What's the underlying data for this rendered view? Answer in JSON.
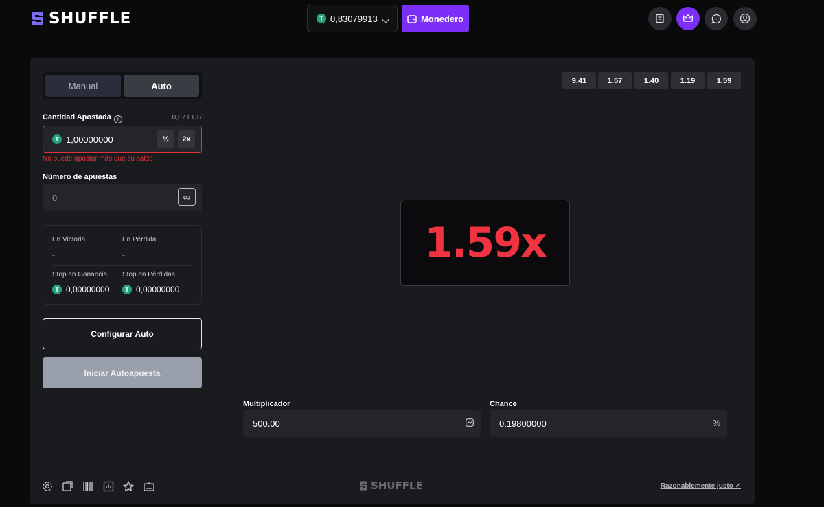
{
  "header": {
    "logo_text": "SHUFFLE",
    "balance": "0,83079913",
    "wallet_label": "Monedero"
  },
  "bet_panel": {
    "tabs": [
      {
        "label": "Manual"
      },
      {
        "label": "Auto"
      }
    ],
    "amount_label": "Cantidad Apostada",
    "amount_fiat": "0,87 EUR",
    "amount_value": "1,00000000",
    "half_label": "½",
    "double_label": "2x",
    "error_text": "No puede apostar más que su saldo",
    "num_bets_label": "Número de apuestas",
    "num_bets_placeholder": "0",
    "infinite_label": "∞",
    "on_win_label": "En Victoria",
    "on_win_value": "-",
    "on_loss_label": "En Pérdida",
    "on_loss_value": "-",
    "stop_profit_label": "Stop en Ganancia",
    "stop_profit_value": "0,00000000",
    "stop_loss_label": "Stop en Pérdidas",
    "stop_loss_value": "0,00000000",
    "configure_label": "Configurar Auto",
    "start_label": "Iniciar Autoapuesta"
  },
  "game": {
    "history": [
      "9.41",
      "1.57",
      "1.40",
      "1.19",
      "1.59"
    ],
    "result": "1.59x",
    "result_color": "#ef3340",
    "multiplier_label": "Multiplicador",
    "multiplier_value": "500.00",
    "chance_label": "Chance",
    "chance_value": "0.19800000",
    "chance_suffix": "%"
  },
  "footer": {
    "logo_text": "SHUFFLE",
    "fair_label": "Razonablemente justo",
    "icons": [
      "settings-icon",
      "popout-icon",
      "barcode-icon",
      "stats-icon",
      "star-icon",
      "keyboard-icon"
    ]
  },
  "colors": {
    "accent": "#7b2ff7",
    "error": "#e0333d",
    "coin": "#26a17b"
  }
}
